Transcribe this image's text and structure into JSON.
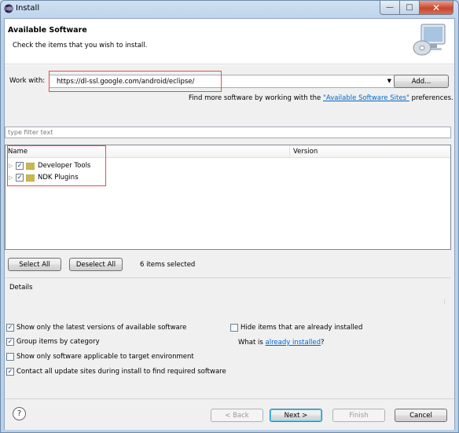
{
  "window": {
    "title": "Install"
  },
  "header": {
    "title": "Available Software",
    "description": "Check the items that you wish to install."
  },
  "work_with": {
    "label": "Work with:",
    "value": "https://dl-ssl.google.com/android/eclipse/",
    "add_label": "Add...",
    "find_more_prefix": "Find more software by working with the ",
    "find_more_link": "\"Available Software Sites\"",
    "find_more_suffix": " preferences."
  },
  "filter": {
    "placeholder": "type filter text"
  },
  "tree": {
    "columns": {
      "name": "Name",
      "version": "Version"
    },
    "items": [
      {
        "label": "Developer Tools",
        "checked": true
      },
      {
        "label": "NDK Plugins",
        "checked": true
      }
    ]
  },
  "selection": {
    "select_all": "Select All",
    "deselect_all": "Deselect All",
    "count_text": "6 items selected"
  },
  "details": {
    "label": "Details"
  },
  "options": {
    "latest_versions": "Show only the latest versions of available software",
    "group_by_category": "Group items by category",
    "applicable_only": "Show only software applicable to target environment",
    "contact_sites": "Contact all update sites during install to find required software",
    "hide_installed": "Hide items that are already installed",
    "what_is_prefix": "What is ",
    "already_installed_link": "already installed",
    "what_is_suffix": "?"
  },
  "footer": {
    "back": "< Back",
    "next": "Next >",
    "finish": "Finish",
    "cancel": "Cancel"
  },
  "colors": {
    "highlight_box": "#e84c4c",
    "link": "#0066cc"
  }
}
